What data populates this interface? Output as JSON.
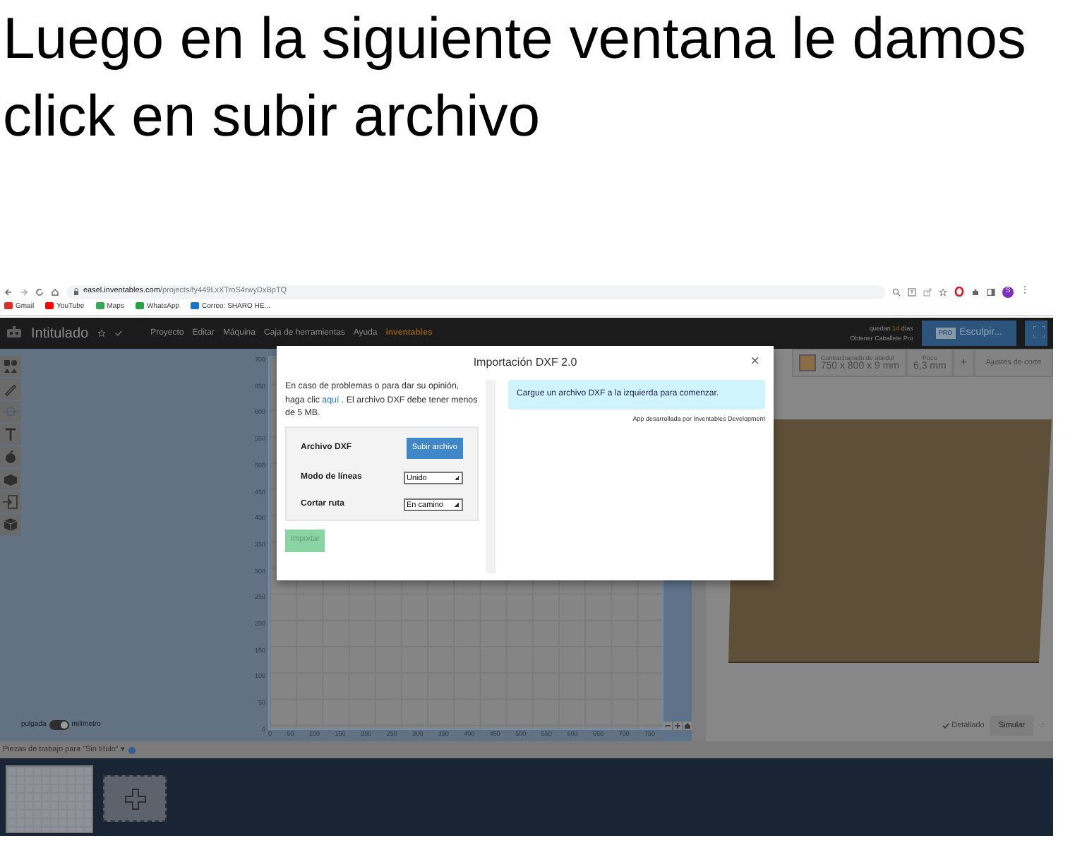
{
  "slide": {
    "heading_lines": [
      "Luego en la siguiente ventana le damos",
      "click en subir archivo"
    ]
  },
  "browser": {
    "address_host": "easel.inventables.com",
    "address_path": "/projects/fy449LxXTroS4rwyDxBpTQ",
    "profile_initial": "S",
    "menu_glyph": "⋮",
    "bookmarks": [
      {
        "label": "Gmail",
        "color": "#d93025"
      },
      {
        "label": "YouTube",
        "color": "#ff0000"
      },
      {
        "label": "Maps",
        "color": "#34a853"
      },
      {
        "label": "WhatsApp",
        "color": "#25a244"
      },
      {
        "label": "Correo: SHARO HE...",
        "color": "#1a73c8"
      }
    ]
  },
  "app": {
    "title": "Intitulado",
    "menu": [
      "Proyecto",
      "Editar",
      "Máquina",
      "Caja de herramientas",
      "Ayuda"
    ],
    "brand": "inventables",
    "trial": {
      "prefix": "quedan",
      "days": "14",
      "suffix": "días"
    },
    "upgrade_link": "Obtener Caballete Pro",
    "carve_button": {
      "badge": "PRO",
      "label": "Esculpir..."
    },
    "material": {
      "name": "Contrachapado de abedul",
      "size": "750 x 800 x 9 mm"
    },
    "bit": {
      "label": "Poco",
      "size": "6,3 mm"
    },
    "add_button": "+",
    "cut_settings": "Ajustes de corte",
    "y_ticks": [
      "700",
      "650",
      "600",
      "550",
      "500",
      "450",
      "400",
      "350",
      "300",
      "250",
      "200",
      "150",
      "100",
      "50",
      "0"
    ],
    "x_ticks": [
      "0",
      "50",
      "100",
      "150",
      "200",
      "250",
      "300",
      "350",
      "400",
      "450",
      "500",
      "550",
      "600",
      "650",
      "700",
      "750"
    ],
    "units": {
      "left": "pulgada",
      "right": "milímetro",
      "metric": true
    },
    "detail": {
      "label": "Detallado",
      "checked": true
    },
    "simulate": "Simular",
    "more": "⋮",
    "workpieces": {
      "label": "Piezas de trabajo para \"Sin título\"",
      "caret": "▾"
    }
  },
  "dialog": {
    "title": "Importación DXF 2.0",
    "close": "×",
    "intro_before": "En caso de problemas o para dar su opinión, haga clic ",
    "intro_link": "aquí",
    "intro_after": " . El archivo DXF debe tener menos de 5 MB.",
    "fields": [
      {
        "kind": "upload",
        "label": "Archivo DXF",
        "value": "Subir archivo"
      },
      {
        "kind": "select",
        "label": "Modo de líneas",
        "value": "Unido"
      },
      {
        "kind": "select",
        "label": "Cortar ruta",
        "value": "En camino"
      }
    ],
    "import_button": {
      "label": "Importar",
      "disabled": true
    },
    "alert": "Cargue un archivo DXF a la izquierda para comenzar.",
    "credit": "App desarrollada por Inventables Development"
  }
}
